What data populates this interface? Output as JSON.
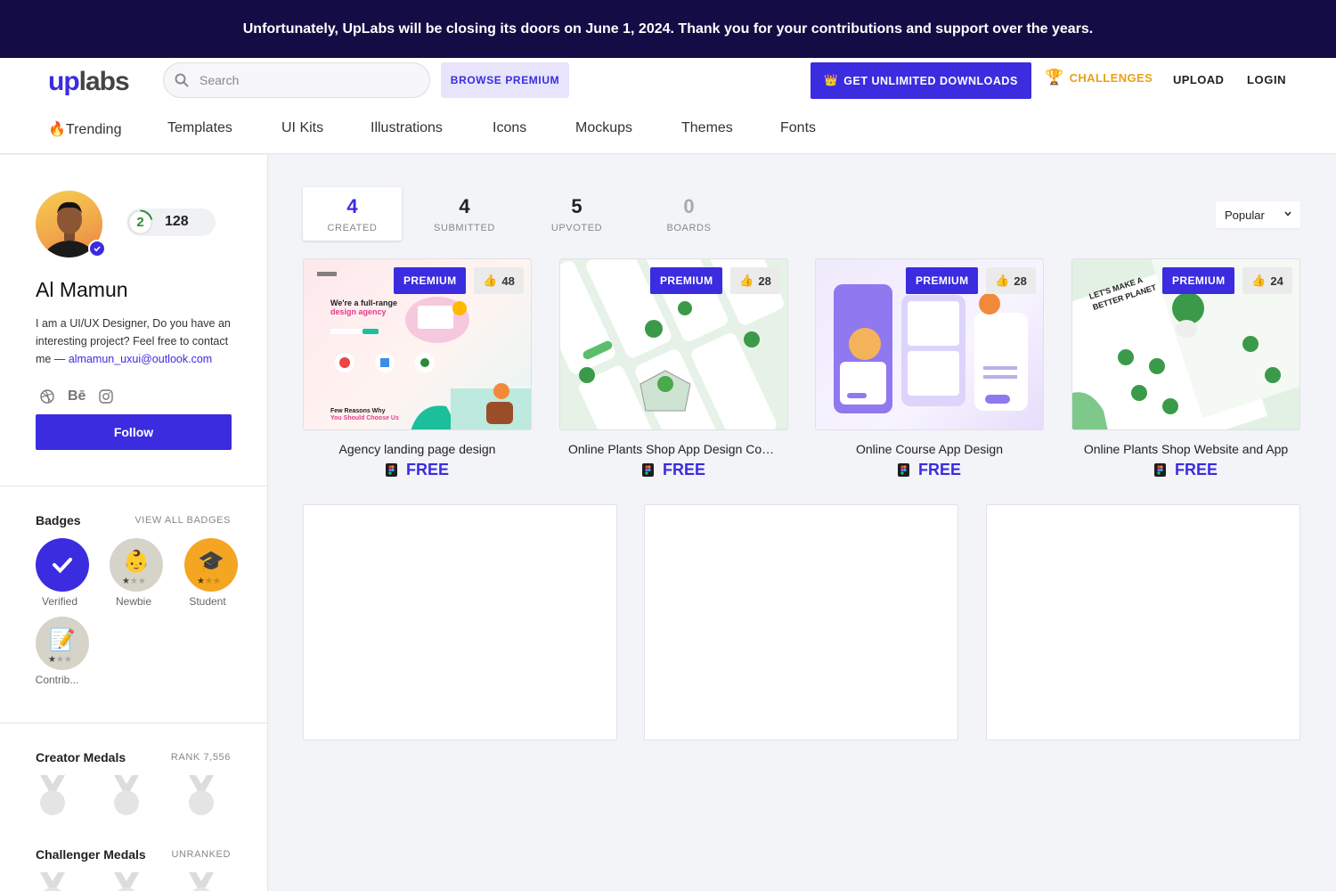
{
  "banner": {
    "text": "Unfortunately, UpLabs will be closing its doors on June 1, 2024. Thank you for your contributions and support over the years."
  },
  "header": {
    "logo_up": "up",
    "logo_labs": "labs",
    "search_placeholder": "Search",
    "browse_premium": "BROWSE PREMIUM",
    "get_unlimited": "GET UNLIMITED DOWNLOADS",
    "challenges": "CHALLENGES",
    "upload": "UPLOAD",
    "login": "LOGIN",
    "accent": "#3b2ce0"
  },
  "categories": [
    "🔥Trending",
    "Templates",
    "UI Kits",
    "Illustrations",
    "Icons",
    "Mockups",
    "Themes",
    "Fonts"
  ],
  "profile": {
    "level": "2",
    "points": "128",
    "name": "Al Mamun",
    "bio": "I am a UI/UX Designer, Do you have an interesting project? Feel free to contact me — ",
    "email": "almamun_uxui@outlook.com",
    "social_icons": [
      "dribbble-icon",
      "behance-icon",
      "instagram-icon"
    ],
    "follow_label": "Follow"
  },
  "badges": {
    "title": "Badges",
    "view_all": "VIEW ALL BADGES",
    "items": [
      {
        "label": "Verified",
        "icon": "check-icon",
        "rating": 0
      },
      {
        "label": "Newbie",
        "icon": "baby-icon",
        "rating": 1
      },
      {
        "label": "Student",
        "icon": "graduation-cap-icon",
        "rating": 1
      },
      {
        "label": "Contrib...",
        "icon": "memo-icon",
        "rating": 1
      }
    ]
  },
  "creator_medals": {
    "title": "Creator Medals",
    "rank": "RANK 7,556"
  },
  "challenger_medals": {
    "title": "Challenger Medals",
    "rank": "UNRANKED"
  },
  "tabs": [
    {
      "count": "4",
      "label": "CREATED",
      "active": true
    },
    {
      "count": "4",
      "label": "SUBMITTED",
      "active": false
    },
    {
      "count": "5",
      "label": "UPVOTED",
      "active": false
    },
    {
      "count": "0",
      "label": "BOARDS",
      "active": false
    }
  ],
  "sort": {
    "selected": "Popular"
  },
  "cards": [
    {
      "title": "Agency landing page design",
      "tag": "PREMIUM",
      "likes": "48",
      "price": "FREE",
      "tool_icon": "figma-icon"
    },
    {
      "title": "Online Plants Shop App Design Concept",
      "tag": "PREMIUM",
      "likes": "28",
      "price": "FREE",
      "tool_icon": "figma-icon"
    },
    {
      "title": "Online Course App Design",
      "tag": "PREMIUM",
      "likes": "28",
      "price": "FREE",
      "tool_icon": "figma-icon"
    },
    {
      "title": "Online Plants Shop Website and App",
      "tag": "PREMIUM",
      "likes": "24",
      "price": "FREE",
      "tool_icon": "figma-icon"
    }
  ]
}
